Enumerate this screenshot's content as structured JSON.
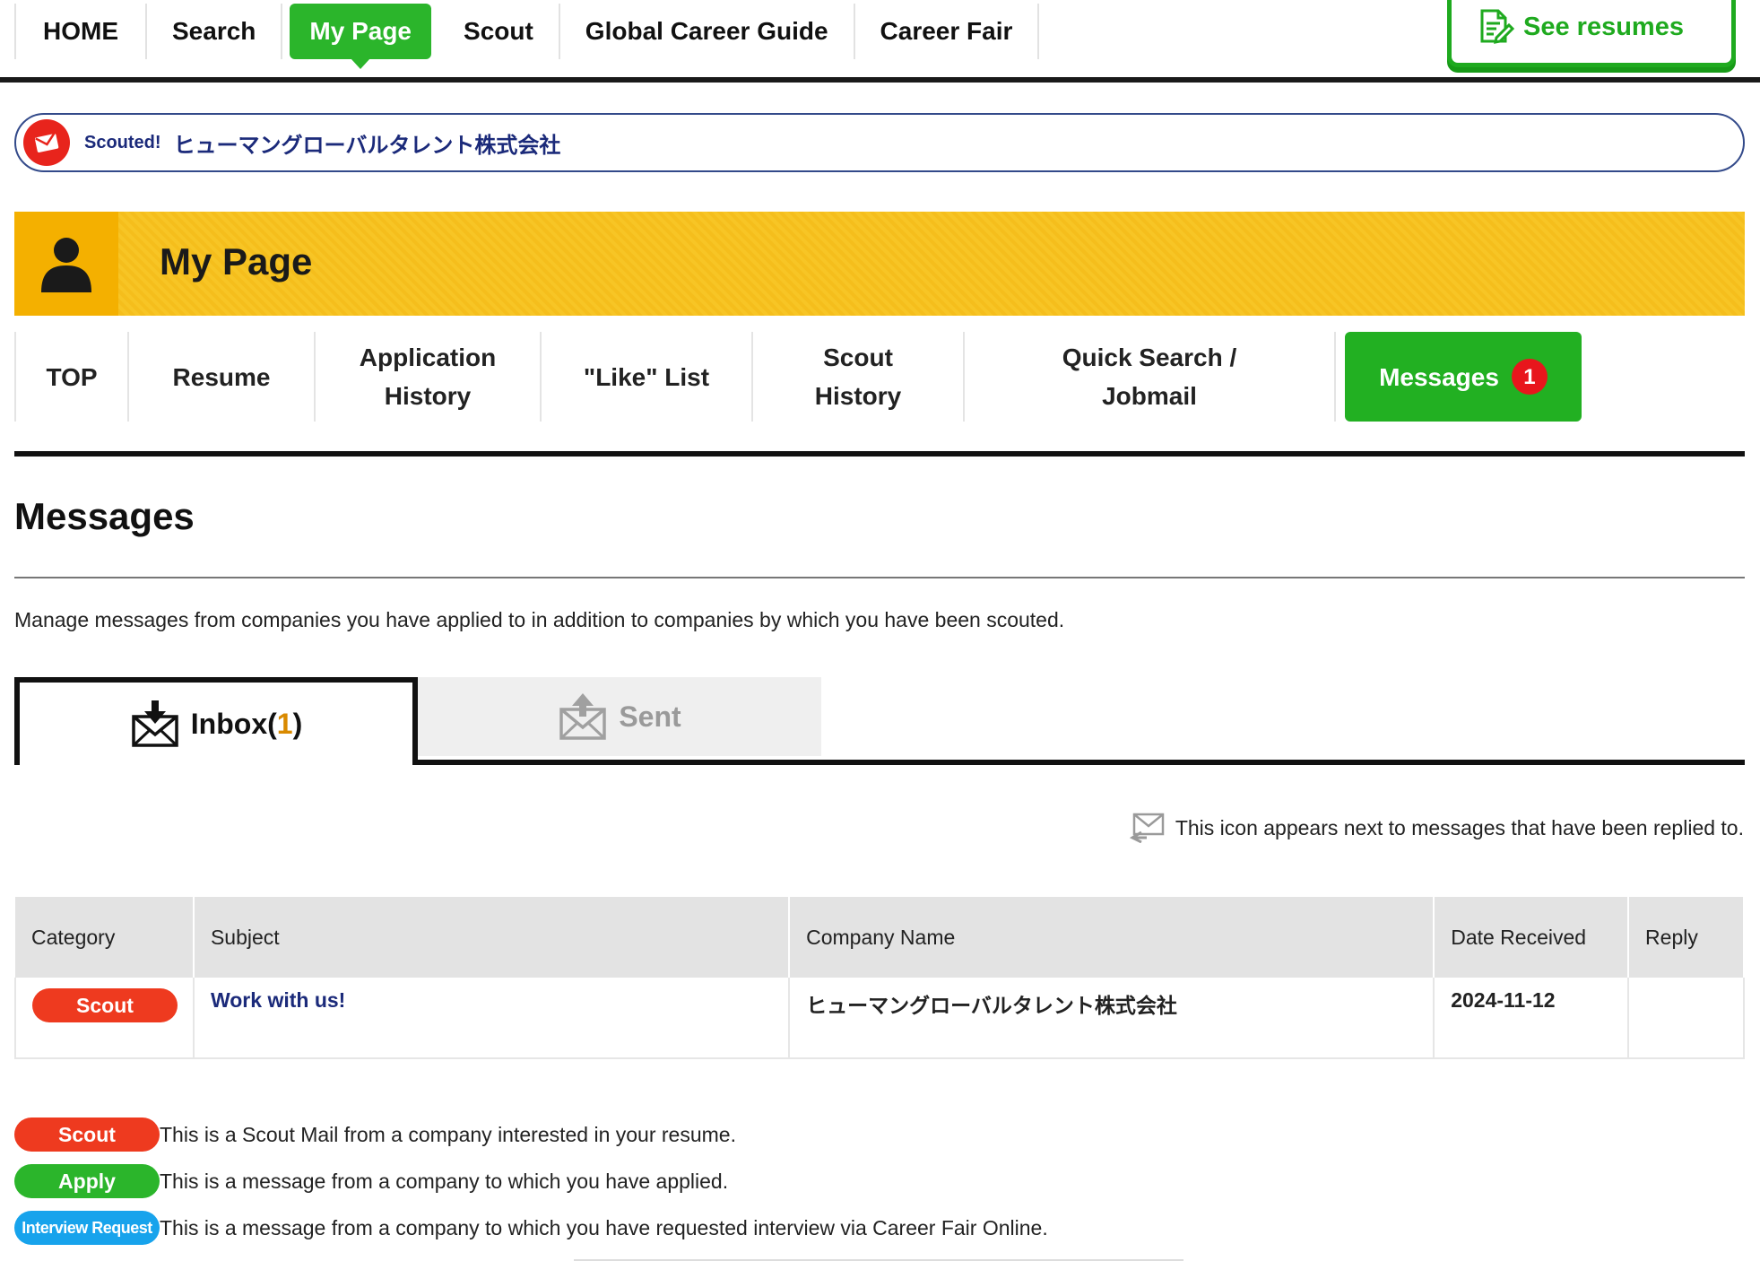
{
  "topnav": {
    "items": [
      "HOME",
      "Search",
      "My Page",
      "Scout",
      "Global Career Guide",
      "Career Fair"
    ],
    "active": "My Page",
    "see_resumes": "See resumes"
  },
  "scouted_banner": {
    "tag": "Scouted!",
    "company": "ヒューマングローバルタレント株式会社"
  },
  "mypage": {
    "title": "My Page"
  },
  "subnav": {
    "items": [
      {
        "label": "TOP"
      },
      {
        "label": "Resume"
      },
      {
        "label_line1": "Application",
        "label_line2": "History"
      },
      {
        "label": "\"Like\" List"
      },
      {
        "label_line1": "Scout",
        "label_line2": "History"
      },
      {
        "label_line1": "Quick Search /",
        "label_line2": "Jobmail"
      },
      {
        "label": "Messages",
        "badge": "1"
      }
    ]
  },
  "messages": {
    "title": "Messages",
    "description": "Manage messages from companies you have applied to in addition to companies by which you have been scouted.",
    "tabs": {
      "inbox_label": "Inbox(",
      "inbox_count": "1",
      "inbox_close": ")",
      "sent_label": "Sent"
    },
    "reply_note": "This icon appears next to messages that have been replied to.",
    "table": {
      "headers": [
        "Category",
        "Subject",
        "Company Name",
        "Date Received",
        "Reply"
      ],
      "rows": [
        {
          "category": "Scout",
          "subject": "Work with us!",
          "company": "ヒューマングローバルタレント株式会社",
          "date": "2024-11-12",
          "reply": ""
        }
      ]
    },
    "legend": [
      {
        "pill": "Scout",
        "text": "This is a Scout Mail from a company interested in your resume."
      },
      {
        "pill": "Apply",
        "text": "This is a message from a company to which you have applied."
      },
      {
        "pill": "Interview Request",
        "text": "This is a message from a company to which you have requested interview via Career Fair Online."
      }
    ]
  },
  "colors": {
    "green": "#2bb52b",
    "yellow": "#f7c525",
    "scout_red": "#ee3a1f",
    "interview_blue": "#17a3ec",
    "navy": "#1b2a7a"
  }
}
